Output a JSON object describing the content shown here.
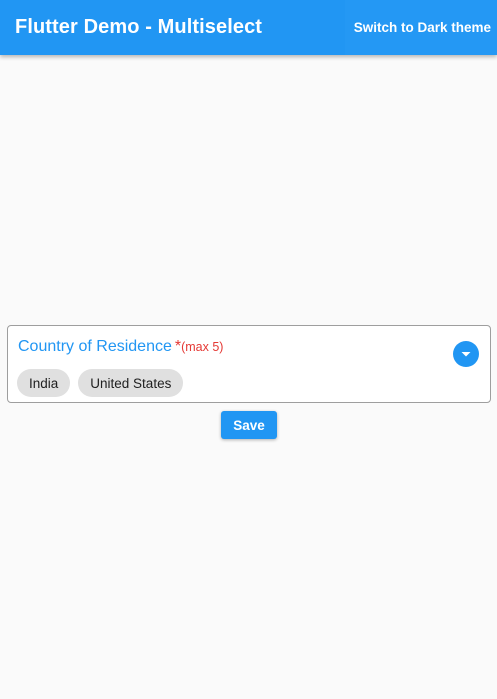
{
  "appbar": {
    "title": "Flutter Demo - Multiselect",
    "theme_button": "Switch to Dark theme"
  },
  "field": {
    "label": "Country of Residence",
    "required_mark": "*",
    "max_hint": "(max 5)",
    "dropdown_icon": "chevron-down-icon",
    "selected": [
      {
        "label": "India"
      },
      {
        "label": "United States"
      }
    ]
  },
  "actions": {
    "save_label": "Save"
  },
  "colors": {
    "primary": "#2196f3",
    "error": "#e53935",
    "chip_bg": "#e0e0e0",
    "background": "#fafafa"
  }
}
